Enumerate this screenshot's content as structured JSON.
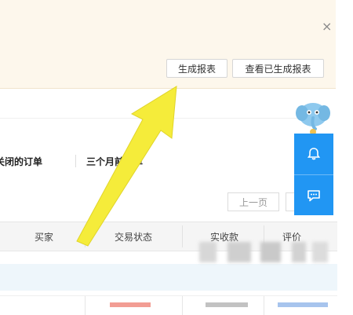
{
  "notice": {
    "close_glyph": "×",
    "generate_button": "生成报表",
    "view_button": "查看已生成报表"
  },
  "tabs": {
    "closed_orders": "关闭的订单",
    "three_months_ago": "三个月前订单"
  },
  "pager": {
    "prev": "上一页",
    "next": ""
  },
  "table": {
    "headers": [
      "买家",
      "交易状态",
      "实收款",
      "评价"
    ]
  },
  "side": {
    "bell_icon": "bell-icon",
    "chat_icon": "chat-icon"
  },
  "colors": {
    "notice_bg": "#fdf7ec",
    "side_blue": "#2196f3",
    "arrow_yellow": "#f5ec3a"
  }
}
